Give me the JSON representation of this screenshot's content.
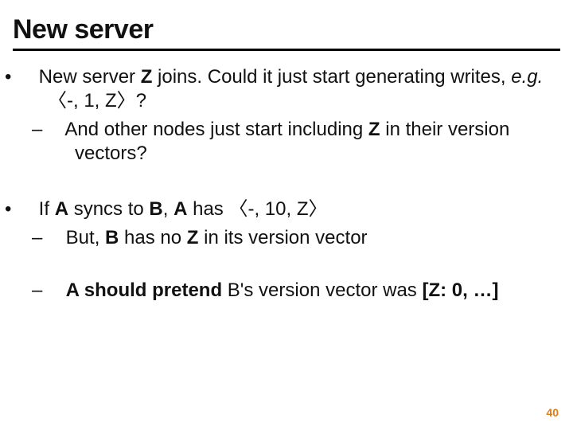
{
  "title": "New server",
  "bullets": {
    "b1a_pre": "New server ",
    "b1a_z": "Z",
    "b1a_mid": " joins.  Could it just start generating writes, ",
    "b1a_eg": "e.g.",
    "b1a_post": " 〈-, 1, Z〉?",
    "b2a_pre": "And other nodes just start including ",
    "b2a_z": "Z",
    "b2a_post": " in their version vectors?",
    "b1b_pre": "If ",
    "b1b_a": "A",
    "b1b_mid1": " syncs to ",
    "b1b_b": "B",
    "b1b_mid2": ", ",
    "b1b_a2": "A",
    "b1b_post": " has 〈-, 10, Z〉",
    "b2b_pre": "But, ",
    "b2b_b": "B",
    "b2b_mid": " has no ",
    "b2b_z": "Z",
    "b2b_post": " in its version vector",
    "b2c_a": "A",
    "b2c_mid1": " should pretend ",
    "b2c_mid2": "B's version vector was ",
    "b2c_vec": "[Z: 0, …]"
  },
  "dot": "•",
  "dash": "–",
  "pagenum": "40"
}
